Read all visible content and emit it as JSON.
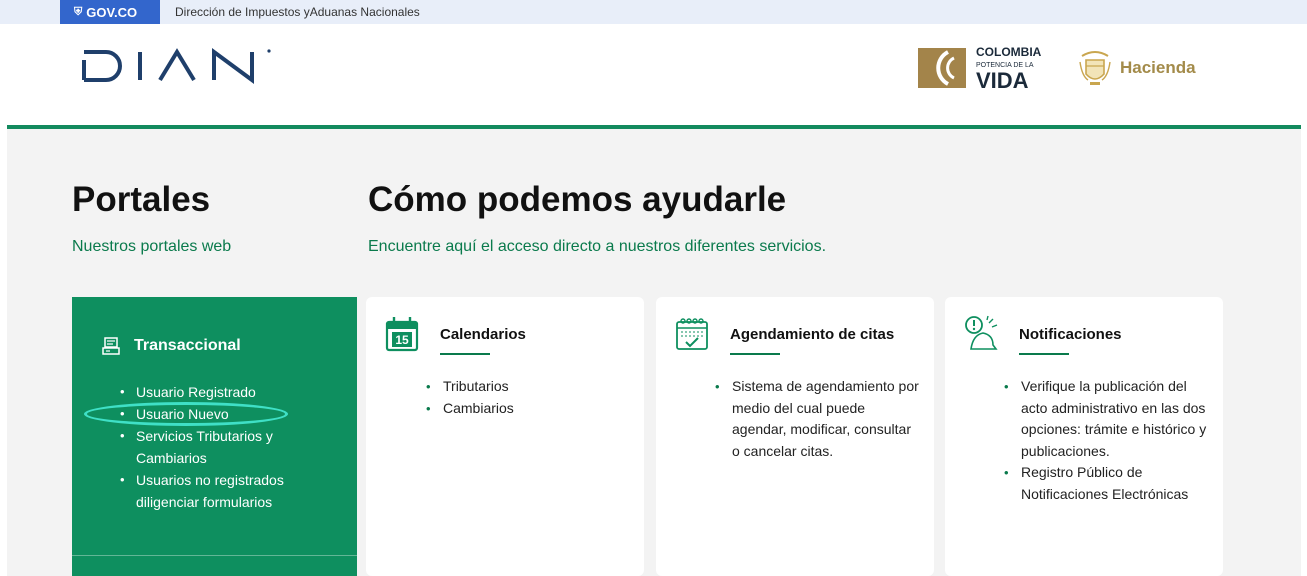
{
  "govbar": {
    "logo": "GOV.CO",
    "text": "Dirección de Impuestos yAduanas Nacionales"
  },
  "header": {
    "brand": "DIAN",
    "colombia_lines": [
      "COLOMBIA",
      "POTENCIA DE LA",
      "VIDA"
    ],
    "hacienda": "Hacienda"
  },
  "portales": {
    "title": "Portales",
    "subtitle": "Nuestros portales web"
  },
  "ayuda": {
    "title": "Cómo podemos ayudarle",
    "subtitle": "Encuentre aquí el acceso directo a nuestros diferentes servicios."
  },
  "transaccional": {
    "title": "Transaccional",
    "items": [
      "Usuario Registrado",
      "Usuario Nuevo",
      "Servicios Tributarios y Cambiarios",
      "Usuarios no registrados diligenciar formularios"
    ]
  },
  "cards": [
    {
      "title": "Calendarios",
      "icon": "calendar-15-icon",
      "icon_text": "15",
      "items": [
        "Tributarios",
        "Cambiarios"
      ]
    },
    {
      "title": "Agendamiento de citas",
      "icon": "calendar-check-icon",
      "items": [
        "Sistema de agendamiento por medio del cual puede agendar, modificar, consultar o cancelar citas."
      ]
    },
    {
      "title": "Notificaciones",
      "icon": "notification-bell-icon",
      "items": [
        "Verifique la publicación del acto administrativo en las dos opciones: trámite e histórico y publicaciones.",
        "Registro Público de Notificaciones Electrónicas"
      ]
    }
  ],
  "colors": {
    "green": "#0e8f5f",
    "gov_blue": "#3366cc",
    "gold": "#a38b4a",
    "highlight": "#3fe0c6"
  }
}
